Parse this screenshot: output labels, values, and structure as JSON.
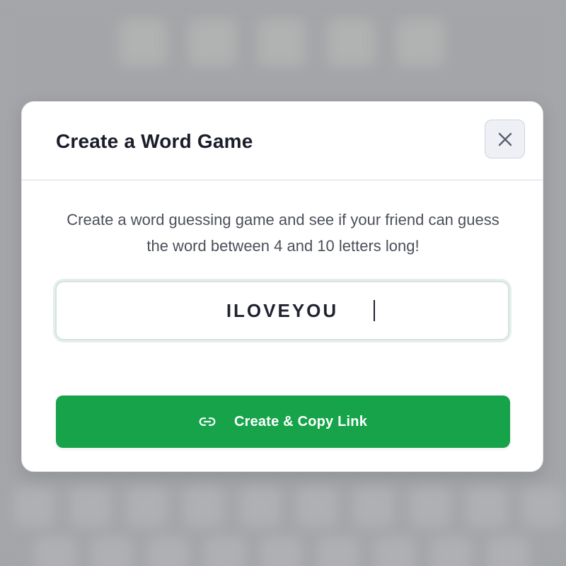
{
  "dialog": {
    "title": "Create a Word Game",
    "close_icon": "close-icon",
    "description": "Create a word guessing game and see if your friend can guess the word between 4 and 10 letters long!",
    "word_input": {
      "value": "ILOVEYOU"
    },
    "create_button": {
      "label": "Create & Copy Link",
      "icon": "link-icon"
    }
  },
  "colors": {
    "accent": "#16a34a",
    "title_text": "#1b1d2b",
    "body_text": "#4b4f5a",
    "backdrop": "#a9aaad"
  }
}
